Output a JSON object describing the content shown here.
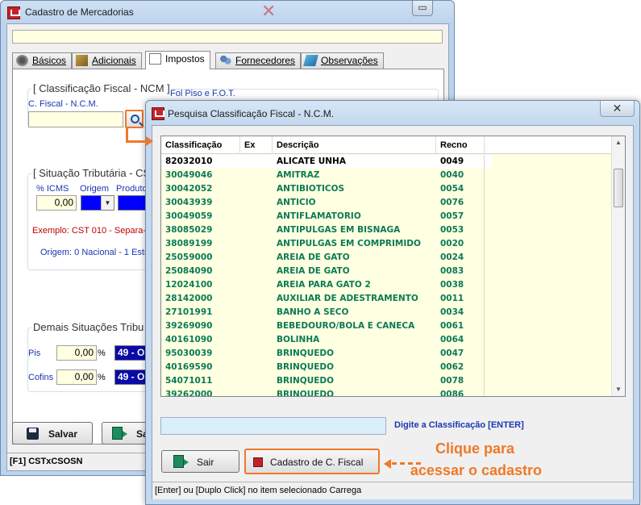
{
  "main_window": {
    "title": "Cadastro de Mercadorias",
    "tabs": [
      {
        "label": "Básicos"
      },
      {
        "label": "Adicionais"
      },
      {
        "label": "Impostos"
      },
      {
        "label": "Fornecedores"
      },
      {
        "label": "Observações"
      }
    ],
    "ncm_group": {
      "title": "[ Classificação Fiscal - NCM ]",
      "field_label": "C. Fiscal - N.C.M.",
      "extra_label": "Fol Piso e F.O.T."
    },
    "tributaria_group": {
      "title": "[ Situação Tributária - CS",
      "icms_label": "% ICMS",
      "icms_value": "0,00",
      "origem_label": "Origem",
      "produto_label": "Produto",
      "example_text": "Exemplo: CST 010 - Separa-se",
      "origem_text": "Origem: 0 Nacional - 1 Estra"
    },
    "demais_group": {
      "title": "Demais Situações Tribu",
      "pis_label": "Pis",
      "pis_value": "0,00",
      "cofins_label": "Cofins",
      "cofins_value": "0,00",
      "percent": "%",
      "pis_combo": "49 - Ou",
      "cofins_combo": "49 - Ou"
    },
    "buttons": {
      "save": "Salvar",
      "exit_partial": "Sa"
    },
    "status": "[F1] CSTxCSOSN"
  },
  "dialog": {
    "title": "Pesquisa Classificação Fiscal - N.C.M.",
    "columns": [
      "Classificação",
      "Ex",
      "Descrição",
      "Recno"
    ],
    "rows": [
      {
        "cls": "82032010",
        "ex": "",
        "desc": "ALICATE UNHA",
        "recno": "0049"
      },
      {
        "cls": "30049046",
        "ex": "",
        "desc": "AMITRAZ",
        "recno": "0040"
      },
      {
        "cls": "30042052",
        "ex": "",
        "desc": "ANTIBIOTICOS",
        "recno": "0054"
      },
      {
        "cls": "30043939",
        "ex": "",
        "desc": "ANTICIO",
        "recno": "0076"
      },
      {
        "cls": "30049059",
        "ex": "",
        "desc": "ANTIFLAMATORIO",
        "recno": "0057"
      },
      {
        "cls": "38085029",
        "ex": "",
        "desc": "ANTIPULGAS EM BISNAGA",
        "recno": "0053"
      },
      {
        "cls": "38089199",
        "ex": "",
        "desc": "ANTIPULGAS EM COMPRIMIDO",
        "recno": "0020"
      },
      {
        "cls": "25059000",
        "ex": "",
        "desc": "AREIA DE GATO",
        "recno": "0024"
      },
      {
        "cls": "25084090",
        "ex": "",
        "desc": "AREIA DE GATO",
        "recno": "0083"
      },
      {
        "cls": "12024100",
        "ex": "",
        "desc": "AREIA PARA GATO 2",
        "recno": "0038"
      },
      {
        "cls": "28142000",
        "ex": "",
        "desc": "AUXILIAR DE ADESTRAMENTO",
        "recno": "0011"
      },
      {
        "cls": "27101991",
        "ex": "",
        "desc": "BANHO A SECO",
        "recno": "0034"
      },
      {
        "cls": "39269090",
        "ex": "",
        "desc": "BEBEDOURO/BOLA E CANECA",
        "recno": "0061"
      },
      {
        "cls": "40161090",
        "ex": "",
        "desc": "BOLINHA",
        "recno": "0064"
      },
      {
        "cls": "95030039",
        "ex": "",
        "desc": "BRINQUEDO",
        "recno": "0047"
      },
      {
        "cls": "40169590",
        "ex": "",
        "desc": "BRINQUEDO",
        "recno": "0062"
      },
      {
        "cls": "54071011",
        "ex": "",
        "desc": "BRINQUEDO",
        "recno": "0078"
      },
      {
        "cls": "39262000",
        "ex": "",
        "desc": "BRINQUEDO",
        "recno": "0086"
      }
    ],
    "search_hint": "Digite a Classificação [ENTER]",
    "buttons": {
      "exit": "Sair",
      "cadastro": "Cadastro de C. Fiscal"
    },
    "status": "[Enter] ou [Duplo Click] no item selecionado Carrega"
  },
  "annotation": {
    "line1": "Clique para",
    "line2": "acessar o cadastro",
    "color": "#f07828"
  },
  "colors": {
    "grid_text": "#0b7a55",
    "label_blue": "#1a36b4",
    "error_red": "#c00000",
    "yellow_bg": "#ffffe1"
  }
}
